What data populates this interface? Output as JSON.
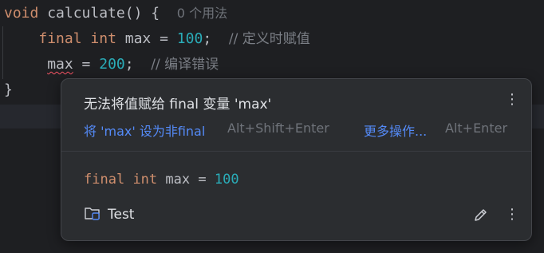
{
  "editor": {
    "line1": {
      "kw": "void",
      "fn": "calculate",
      "punct": "() {",
      "usages": "0 个用法"
    },
    "line2": {
      "kw_final": "final",
      "kw_type": "int",
      "var": "max",
      "op": "=",
      "num": "100",
      "semi": ";",
      "comment": "// 定义时赋值"
    },
    "line3": {
      "var": "max",
      "op": "=",
      "num": "200",
      "semi": ";",
      "comment": "// 编译错误"
    },
    "line4": {
      "brace": "}"
    }
  },
  "popup": {
    "title": "无法将值赋给 final 变量 'max'",
    "quick_fix_label": "将 'max' 设为非final",
    "quick_fix_shortcut": "Alt+Shift+Enter",
    "more_actions_label": "更多操作...",
    "more_actions_shortcut": "Alt+Enter",
    "snippet": {
      "kw_final": "final",
      "kw_type": "int",
      "var": "max",
      "op": "=",
      "num": "100"
    },
    "module_name": "Test",
    "icons": [
      "more-vertical-icon",
      "folder-module-icon",
      "edit-icon"
    ]
  },
  "colors": {
    "background": "#1e1f22",
    "popup_bg": "#2b2d30",
    "keyword": "#cf8e6d",
    "number": "#2aacb8",
    "link": "#548af7",
    "error": "#f75464"
  }
}
